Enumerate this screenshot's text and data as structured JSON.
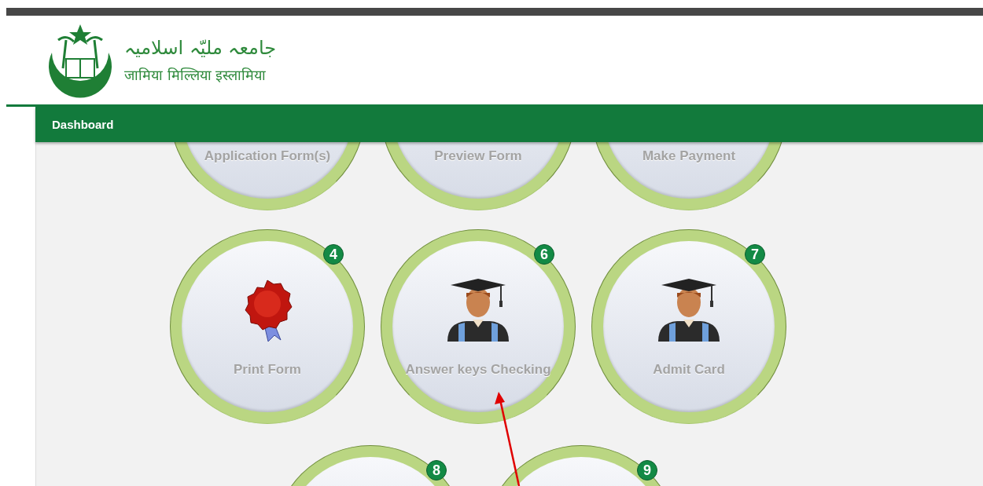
{
  "header": {
    "title_urdu": "جامعہ ملیّہ اسلامیہ",
    "title_hindi": "जामिया मिल्लिया इस्लामिया"
  },
  "nav": {
    "items": [
      {
        "label": "Dashboard",
        "selected": true
      }
    ]
  },
  "tile_rows": [
    {
      "tiles": [
        {
          "label": "Application Form(s)"
        },
        {
          "label": "Preview Form"
        },
        {
          "label": "Make Payment"
        }
      ]
    },
    {
      "tiles": [
        {
          "label": "Print Form",
          "badge": "4",
          "kind": "seal"
        },
        {
          "label": "Answer keys Checking",
          "badge": "6",
          "kind": "graduate"
        },
        {
          "label": "Admit Card",
          "badge": "7",
          "kind": "graduate"
        }
      ]
    },
    {
      "tiles": [
        {
          "badge": "8"
        },
        {
          "badge": "9"
        }
      ]
    }
  ],
  "annotation": {
    "kind": "arrow"
  }
}
